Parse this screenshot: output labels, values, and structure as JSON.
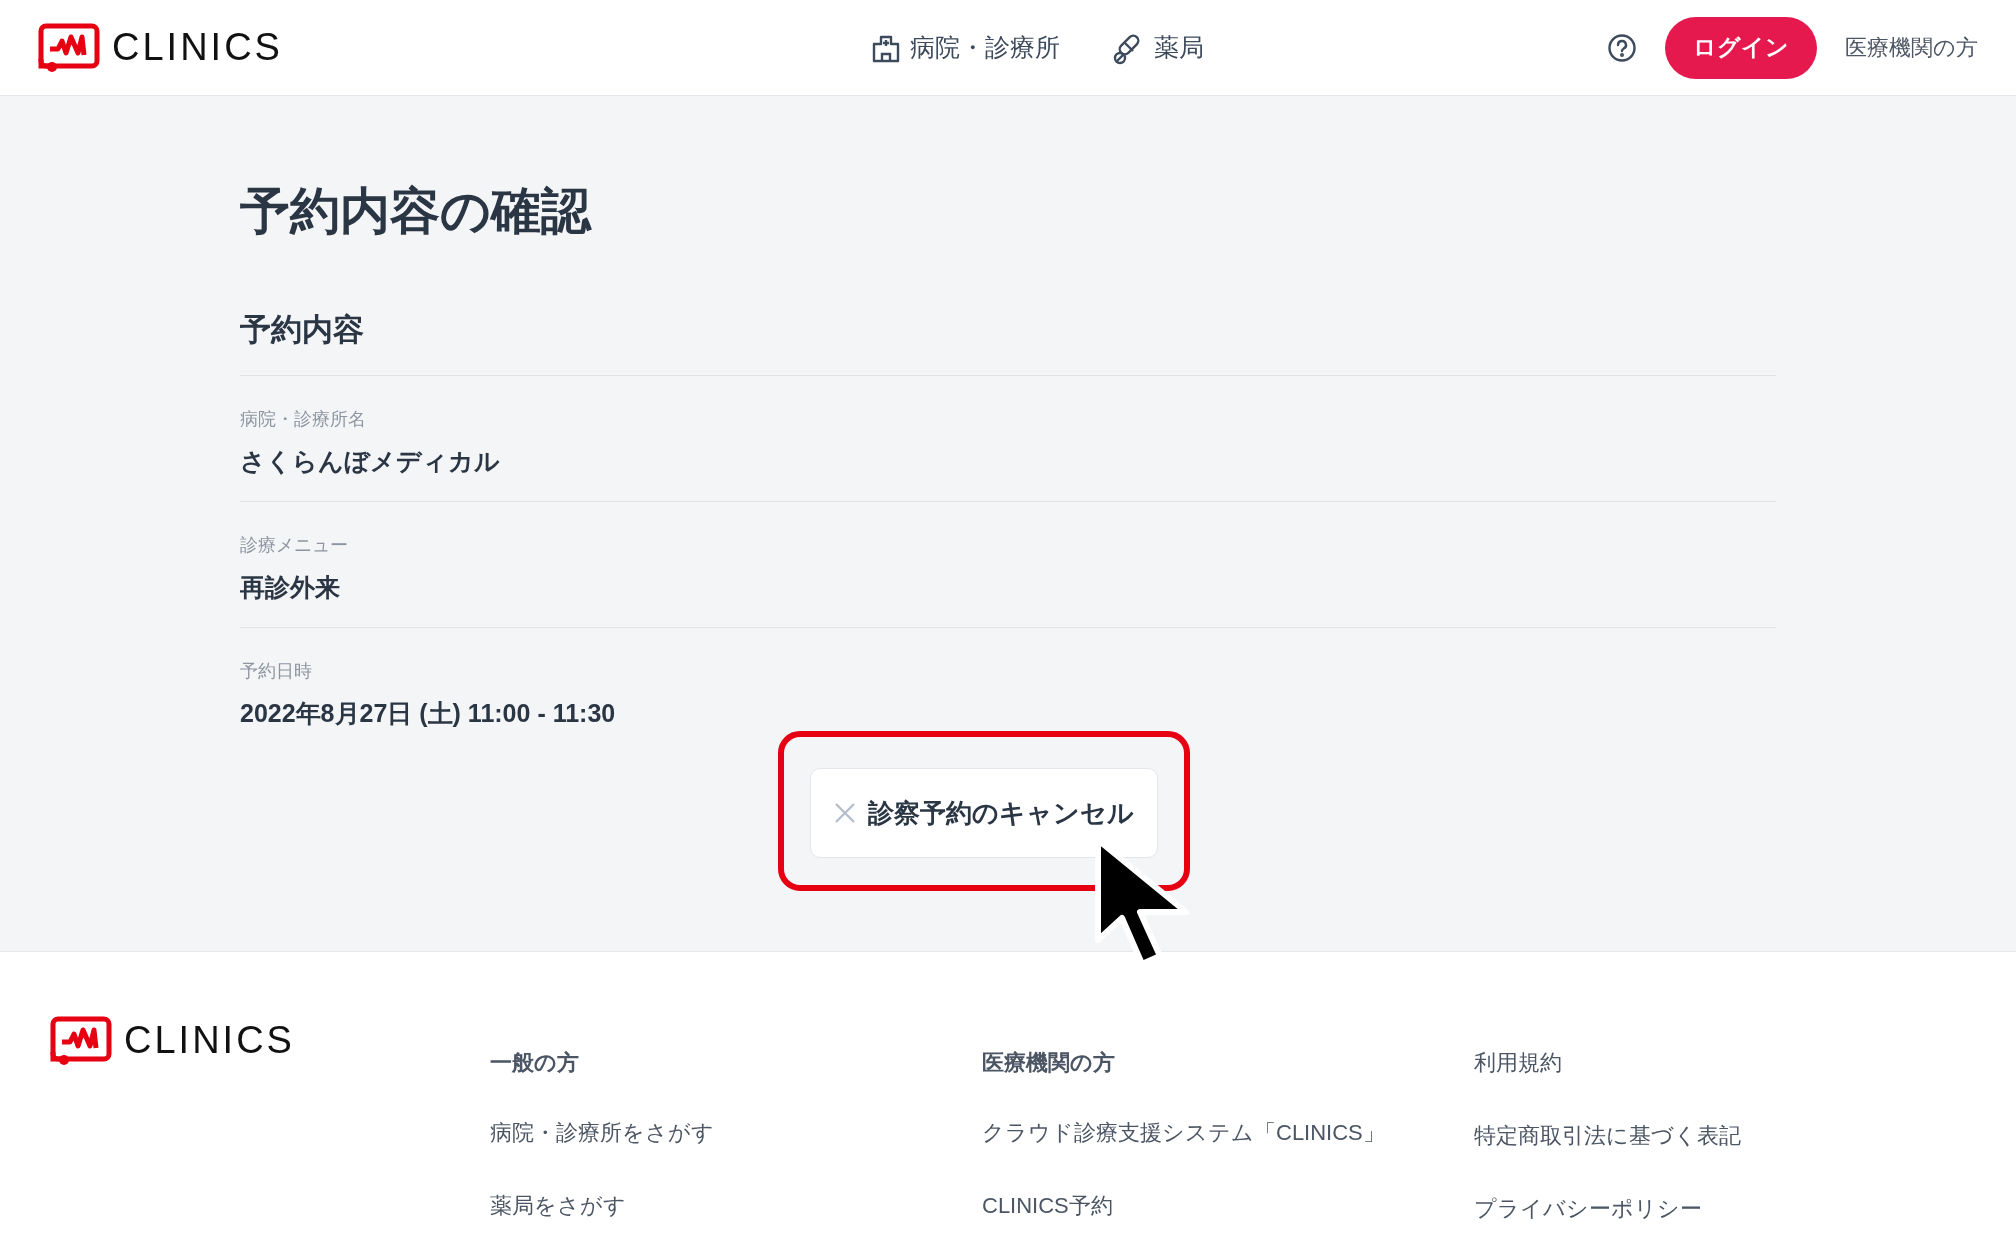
{
  "header": {
    "logo_text": "CLINICS",
    "nav": [
      {
        "kind": "hospital",
        "label": "病院・診療所"
      },
      {
        "kind": "pharmacy",
        "label": "薬局"
      }
    ],
    "login": "ログイン",
    "medical_link": "医療機関の方"
  },
  "page": {
    "title": "予約内容の確認",
    "section": "予約内容",
    "fields": [
      {
        "label": "病院・診療所名",
        "value": "さくらんぼメディカル"
      },
      {
        "label": "診療メニュー",
        "value": "再診外来"
      },
      {
        "label": "予約日時",
        "value": "2022年8月27日 (土) 11:00 - 11:30"
      }
    ],
    "cancel_button": "診察予約のキャンセル"
  },
  "footer": {
    "logo_text": "CLINICS",
    "columns": [
      {
        "heading": "一般の方",
        "links": [
          "病院・診療所をさがす",
          "薬局をさがす"
        ]
      },
      {
        "heading": "医療機関の方",
        "links": [
          "クラウド診療支援システム「CLINICS」",
          "CLINICS予約"
        ]
      },
      {
        "links": [
          "利用規約",
          "特定商取引法に基づく表記",
          "プライバシーポリシー"
        ]
      }
    ]
  }
}
